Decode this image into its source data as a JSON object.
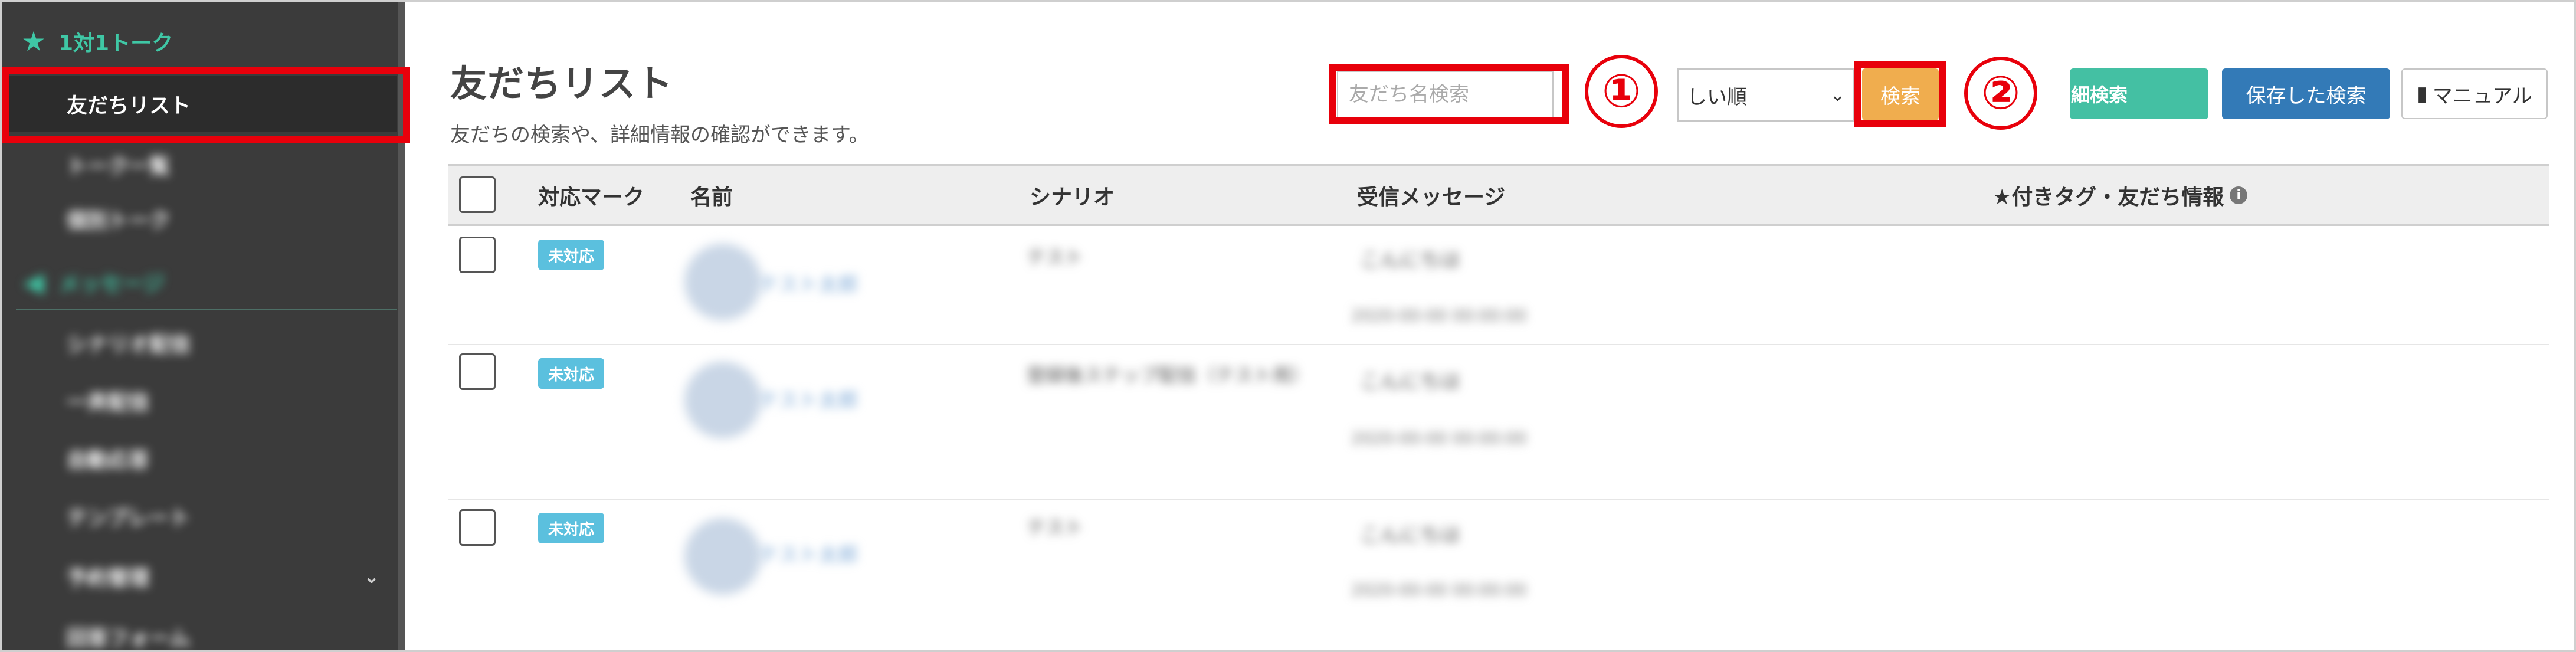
{
  "colors": {
    "sidebar_bg": "#3b3b3b",
    "sidebar_accent": "#3fc7a5",
    "highlight_red": "#e8000b",
    "search_button": "#f0ad4e",
    "detail_search_button": "#44c0a3",
    "saved_search_button": "#337ab7",
    "status_badge": "#5bc0de"
  },
  "sidebar": {
    "section_talk": {
      "icon": "star-icon",
      "label": "1対1トーク"
    },
    "items_talk": [
      {
        "label": "友だちリスト",
        "active": true
      },
      {
        "label": "トーク一覧",
        "blurred": true
      },
      {
        "label": "個別トーク",
        "blurred": true
      }
    ],
    "section_message": {
      "icon": "megaphone-icon",
      "label": "メッセージ",
      "blurred": true
    },
    "items_message": [
      {
        "label": "シナリオ配信"
      },
      {
        "label": "一斉配信"
      },
      {
        "label": "自動応答"
      },
      {
        "label": "テンプレート"
      },
      {
        "label": "予約管理"
      },
      {
        "label": "回答フォーム"
      }
    ]
  },
  "header": {
    "title": "友だちリスト",
    "subtitle": "友だちの検索や、詳細情報の確認ができます。"
  },
  "toolbar": {
    "search_placeholder": "友だち名検索",
    "annotation_1": "①",
    "annotation_2": "②",
    "sort_value": "しい順",
    "search_label": "検索",
    "detail_search_label": "細検索",
    "saved_search_label": "保存した検索",
    "manual_label": "マニュアル"
  },
  "table": {
    "columns": [
      "対応マーク",
      "名前",
      "シナリオ",
      "受信メッセージ",
      "★付きタグ・友だち情報"
    ],
    "rows": [
      {
        "status": "未対応",
        "name": "テスト太郎",
        "scenario": "テスト",
        "message": "こんにちは",
        "time": "2020-00-00 00:00:00"
      },
      {
        "status": "未対応",
        "name": "テスト太郎",
        "scenario": "登録後ステップ配信（テスト用）",
        "message": "こんにちは",
        "time": "2020-00-00 00:00:00"
      },
      {
        "status": "未対応",
        "name": "テスト太郎",
        "scenario": "テスト",
        "message": "こんにちは",
        "time": "2020-00-00 00:00:00"
      }
    ]
  }
}
